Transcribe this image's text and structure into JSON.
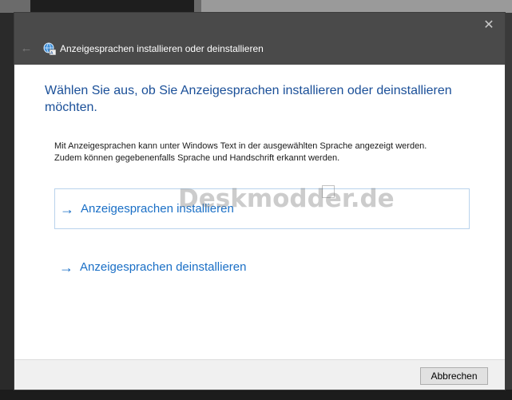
{
  "window": {
    "title": "Anzeigesprachen installieren oder deinstallieren",
    "close_icon": "close-icon",
    "back_icon": "back-arrow-icon",
    "title_icon": "language-globe-icon"
  },
  "content": {
    "heading": "Wählen Sie aus, ob Sie Anzeigesprachen installieren oder deinstallieren möchten.",
    "description_line1": "Mit Anzeigesprachen kann unter Windows Text in der ausgewählten Sprache angezeigt werden.",
    "description_line2": "Zudem können gegebenenfalls Sprache und Handschrift erkannt werden.",
    "options": [
      {
        "label": "Anzeigesprachen installieren",
        "icon": "arrow-right-icon"
      },
      {
        "label": "Anzeigesprachen deinstallieren",
        "icon": "arrow-right-icon"
      }
    ],
    "watermark": "Deskmodder.de"
  },
  "footer": {
    "cancel_label": "Abbrechen"
  },
  "colors": {
    "titlebar": "#4a4a4a",
    "heading": "#1a4f98",
    "link": "#1a6fc6",
    "option_border": "#b9d3ec",
    "footer": "#f0f0f0"
  }
}
